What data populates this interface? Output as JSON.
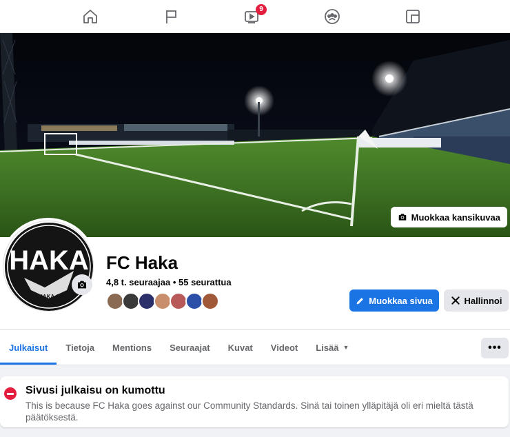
{
  "nav": {
    "icons": [
      "home-icon",
      "flag-icon",
      "watch-icon",
      "groups-icon",
      "gaming-icon"
    ],
    "watch_badge": "9"
  },
  "cover": {
    "edit_label": "Muokkaa kansikuvaa"
  },
  "page": {
    "name": "FC Haka",
    "stats": "4,8 t. seuraajaa • 55 seurattua",
    "logo_text": "HAKA",
    "logo_subtext": "FC HAKA 1934"
  },
  "actions": {
    "edit_page_label": "Muokkaa sivua",
    "manage_label": "Hallinnoi"
  },
  "tabs": [
    {
      "label": "Julkaisut",
      "active": true
    },
    {
      "label": "Tietoja"
    },
    {
      "label": "Mentions"
    },
    {
      "label": "Seuraajat"
    },
    {
      "label": "Kuvat"
    },
    {
      "label": "Videot"
    },
    {
      "label": "Lisää"
    }
  ],
  "more_button": "•••",
  "notice": {
    "title": "Sivusi julkaisu on kumottu",
    "text": "This is because FC Haka goes against our Community Standards. Sinä tai toinen ylläpitäjä oli eri mieltä tästä päätöksestä."
  },
  "colors": {
    "accent": "#1b74e4",
    "badge": "#e41e3f",
    "follower_avatars": [
      "#8a6a52",
      "#3a3a3a",
      "#2b2f6a",
      "#c98e6c",
      "#b85a5a",
      "#2c4fa8",
      "#a05a3a"
    ]
  }
}
